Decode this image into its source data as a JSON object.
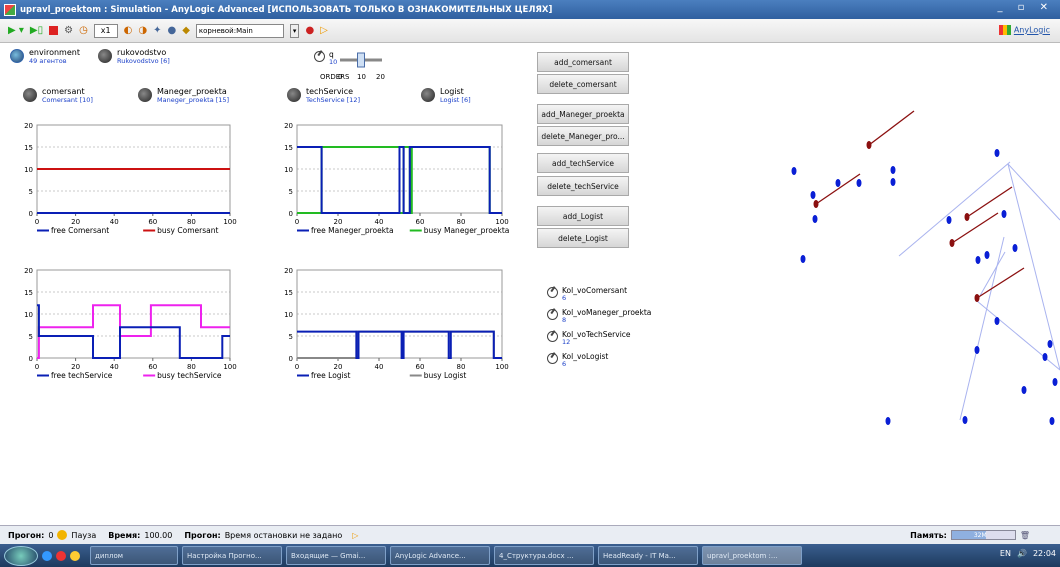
{
  "window": {
    "title": "upravl_proektom : Simulation - AnyLogic Advanced [ИСПОЛЬЗОВАТЬ ТОЛЬКО В ОЗНАКОМИТЕЛЬНЫХ ЦЕЛЯХ]",
    "controls": "_ ▫ ✕"
  },
  "toolbar": {
    "speed": "x1",
    "root_select": "корневой:Main",
    "brand": "AnyLogic"
  },
  "agents": {
    "environment": {
      "name": "environment",
      "count": "49 агентов"
    },
    "rukovodstvo": {
      "name": "rukovodstvo",
      "count": "Rukovodstvo [6]"
    },
    "comersant": {
      "name": "comersant",
      "count": "Comersant [10]"
    },
    "maneger": {
      "name": "Maneger_proekta",
      "count": "Maneger_proekta [15]"
    },
    "tech": {
      "name": "techService",
      "count": "TechService [12]"
    },
    "logist": {
      "name": "Logist",
      "count": "Logist [6]"
    }
  },
  "param_q": {
    "name": "q",
    "value": "10"
  },
  "slider": {
    "label": "ORDERS",
    "min": "0",
    "mid": "10",
    "max": "20",
    "value": 10,
    "range": [
      0,
      20
    ]
  },
  "buttons": {
    "add_comersant": "add_comersant",
    "delete_comersant": "delete_comersant",
    "add_maneger": "add_Maneger_proekta",
    "delete_maneger": "delete_Maneger_pro...",
    "add_tech": "add_techService",
    "delete_tech": "delete_techService",
    "add_logist": "add_Logist",
    "delete_logist": "delete_Logist"
  },
  "variables": [
    {
      "name": "Kol_voComersant",
      "value": "6"
    },
    {
      "name": "Kol_voManeger_proekta",
      "value": "8"
    },
    {
      "name": "Kol_voTechService",
      "value": "12"
    },
    {
      "name": "Kol_voLogist",
      "value": "6"
    }
  ],
  "status": {
    "run_label": "Прогон:",
    "run_value": "0",
    "pause": "Пауза",
    "time_label": "Время:",
    "time_value": "100.00",
    "stop_label": "Прогон:",
    "stop_value": "Время остановки не задано",
    "memory_label": "Память:",
    "memory_value": "32M"
  },
  "taskbar": {
    "items": [
      "диплом",
      "Настройка Прогно...",
      "Входящие — Gmai...",
      "AnyLogic Advance...",
      "4_Структура.docx ...",
      "HeadReady - IT Ма...",
      "upravl_proektom :..."
    ],
    "lang": "EN",
    "clock": "22:04"
  },
  "colors": {
    "free": "#0a1fb5",
    "busy_comersant": "#cc1111",
    "busy_maneger": "#22bb22",
    "busy_tech": "#ee22ee",
    "busy_logist": "#888888",
    "agent_blue": "#0a1fd5",
    "agent_red": "#8b1010"
  },
  "chart_data": [
    {
      "type": "line",
      "title": "",
      "xlabel": "",
      "ylabel": "",
      "xlim": [
        0,
        100
      ],
      "ylim": [
        0,
        20
      ],
      "xticks": [
        0,
        20,
        40,
        60,
        80,
        100
      ],
      "yticks": [
        0,
        5,
        10,
        15,
        20
      ],
      "legend": "bottom",
      "series": [
        {
          "name": "free Comersant",
          "color": "#0a1fb5",
          "points": [
            [
              0,
              0
            ],
            [
              100,
              0
            ]
          ]
        },
        {
          "name": "busy Comersant",
          "color": "#cc1111",
          "points": [
            [
              0,
              10
            ],
            [
              100,
              10
            ]
          ]
        }
      ]
    },
    {
      "type": "line",
      "title": "",
      "xlabel": "",
      "ylabel": "",
      "xlim": [
        0,
        100
      ],
      "ylim": [
        0,
        20
      ],
      "xticks": [
        0,
        20,
        40,
        60,
        80,
        100
      ],
      "yticks": [
        0,
        5,
        10,
        15,
        20
      ],
      "legend": "bottom",
      "series": [
        {
          "name": "free Maneger_proekta",
          "color": "#0a1fb5",
          "points": [
            [
              0,
              15
            ],
            [
              12,
              15
            ],
            [
              12,
              0
            ],
            [
              50,
              0
            ],
            [
              50,
              15
            ],
            [
              52,
              15
            ],
            [
              52,
              0
            ],
            [
              55,
              0
            ],
            [
              55,
              15
            ],
            [
              94,
              15
            ],
            [
              94,
              0
            ],
            [
              100,
              0
            ]
          ]
        },
        {
          "name": "busy Maneger_proekta",
          "color": "#22bb22",
          "points": [
            [
              0,
              0
            ],
            [
              12,
              0
            ],
            [
              12,
              15
            ],
            [
              50,
              15
            ],
            [
              50,
              0
            ],
            [
              52,
              0
            ],
            [
              52,
              15
            ],
            [
              55,
              15
            ],
            [
              55,
              0
            ],
            [
              56,
              0
            ],
            [
              56,
              15
            ],
            [
              94,
              15
            ],
            [
              94,
              0
            ],
            [
              100,
              0
            ]
          ]
        }
      ]
    },
    {
      "type": "line",
      "title": "",
      "xlabel": "",
      "ylabel": "",
      "xlim": [
        0,
        100
      ],
      "ylim": [
        0,
        20
      ],
      "xticks": [
        0,
        20,
        40,
        60,
        80,
        100
      ],
      "yticks": [
        0,
        5,
        10,
        15,
        20
      ],
      "legend": "bottom",
      "series": [
        {
          "name": "free techService",
          "color": "#0a1fb5",
          "points": [
            [
              0,
              12
            ],
            [
              1,
              12
            ],
            [
              1,
              5
            ],
            [
              29,
              5
            ],
            [
              29,
              0
            ],
            [
              43,
              0
            ],
            [
              43,
              7
            ],
            [
              74,
              7
            ],
            [
              74,
              0
            ],
            [
              96,
              0
            ],
            [
              96,
              5
            ],
            [
              100,
              5
            ]
          ]
        },
        {
          "name": "busy techService",
          "color": "#ee22ee",
          "points": [
            [
              0,
              0
            ],
            [
              1,
              0
            ],
            [
              1,
              7
            ],
            [
              29,
              7
            ],
            [
              29,
              12
            ],
            [
              43,
              12
            ],
            [
              43,
              5
            ],
            [
              59,
              5
            ],
            [
              59,
              12
            ],
            [
              85,
              12
            ],
            [
              85,
              7
            ],
            [
              100,
              7
            ]
          ]
        }
      ]
    },
    {
      "type": "line",
      "title": "",
      "xlabel": "",
      "ylabel": "",
      "xlim": [
        0,
        100
      ],
      "ylim": [
        0,
        20
      ],
      "xticks": [
        0,
        20,
        40,
        60,
        80,
        100
      ],
      "yticks": [
        0,
        5,
        10,
        15,
        20
      ],
      "legend": "bottom",
      "series": [
        {
          "name": "free Logist",
          "color": "#0a1fb5",
          "points": [
            [
              0,
              6
            ],
            [
              29,
              6
            ],
            [
              29,
              0
            ],
            [
              30,
              0
            ],
            [
              30,
              6
            ],
            [
              51,
              6
            ],
            [
              51,
              0
            ],
            [
              52,
              0
            ],
            [
              52,
              6
            ],
            [
              74,
              6
            ],
            [
              74,
              0
            ],
            [
              75,
              0
            ],
            [
              75,
              6
            ],
            [
              96,
              6
            ],
            [
              96,
              0
            ],
            [
              100,
              0
            ]
          ]
        },
        {
          "name": "busy Logist",
          "color": "#888888",
          "points": [
            [
              0,
              0
            ],
            [
              29,
              0
            ],
            [
              29,
              6
            ],
            [
              96,
              6
            ],
            [
              96,
              0
            ],
            [
              100,
              0
            ]
          ]
        }
      ]
    }
  ]
}
